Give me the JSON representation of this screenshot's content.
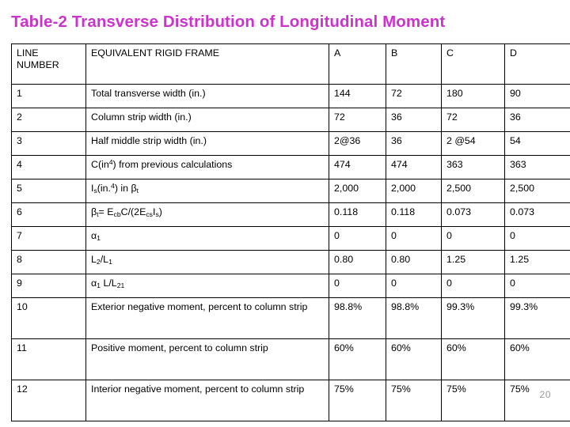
{
  "slide": {
    "title": "Table-2  Transverse Distribution of Longitudinal Moment",
    "title_color": "#cc33cc",
    "page_number": "20"
  },
  "table": {
    "headers": {
      "line_number_l1": "LINE",
      "line_number_l2": "NUMBER",
      "description": "EQUIVALENT RIGID FRAME",
      "col_a": "A",
      "col_b": "B",
      "col_c": "C",
      "col_d": "D"
    },
    "rows": [
      {
        "line": "1",
        "desc_pre": "Total transverse width (in.)",
        "desc_sub": "",
        "desc_mid": "",
        "desc_sub2": "",
        "desc_post": "",
        "a": "144",
        "b": "72",
        "c": "180",
        "d": "90"
      },
      {
        "line": "2",
        "desc_pre": "Column strip width (in.)",
        "desc_sub": "",
        "desc_mid": "",
        "desc_sub2": "",
        "desc_post": "",
        "a": "72",
        "b": "36",
        "c": "72",
        "d": "36"
      },
      {
        "line": "3",
        "desc_pre": "Half middle strip width (in.)",
        "desc_sub": "",
        "desc_mid": "",
        "desc_sub2": "",
        "desc_post": "",
        "a": "2@36",
        "b": "36",
        "c": "2 @54",
        "d": "54"
      },
      {
        "line": "4",
        "desc_pre": "C(in",
        "desc_sup": "4",
        "desc_post": ") from previous calculations",
        "a": "474",
        "b": "474",
        "c": "363",
        "d": "363"
      },
      {
        "line": "5",
        "desc_pre": "I",
        "desc_sub": "s",
        "desc_mid": "(in.",
        "desc_sup": "4",
        "desc_mid2": ") in β",
        "desc_sub2": "t",
        "desc_post": "",
        "a": "2,000",
        "b": "2,000",
        "c": "2,500",
        "d": "2,500"
      },
      {
        "line": "6",
        "desc_pre": "β",
        "desc_sub": "t",
        "desc_mid": "= E",
        "desc_sub2": "cb",
        "desc_mid2": "C/(2E",
        "desc_sub3": "cs",
        "desc_mid3": "I",
        "desc_sub4": "s",
        "desc_post": ")",
        "a": "0.118",
        "b": "0.118",
        "c": "0.073",
        "d": "0.073"
      },
      {
        "line": "7",
        "desc_pre": "α",
        "desc_sub": "1",
        "desc_post": "",
        "a": "0",
        "b": "0",
        "c": "0",
        "d": "0"
      },
      {
        "line": "8",
        "desc_pre": "L",
        "desc_sub": "2",
        "desc_mid": "/L",
        "desc_sub2": "1",
        "desc_post": "",
        "a": "0.80",
        "b": "0.80",
        "c": "1.25",
        "d": "1.25"
      },
      {
        "line": "9",
        "desc_pre": "α",
        "desc_sub": "1",
        "desc_mid": " L",
        "desc_sub2": "2",
        "desc_mid2": "/L",
        "desc_sub3": "1",
        "desc_post": "",
        "a": "0",
        "b": "0",
        "c": "0",
        "d": "0"
      },
      {
        "line": "10",
        "desc_pre": "Exterior negative moment, percent to column strip",
        "a": "98.8%",
        "b": "98.8%",
        "c": "99.3%",
        "d": "99.3%"
      },
      {
        "line": "11",
        "desc_pre": "Positive moment, percent to column strip",
        "a": "60%",
        "b": "60%",
        "c": "60%",
        "d": "60%"
      },
      {
        "line": "12",
        "desc_pre": "Interior negative moment, percent to column strip",
        "a": "75%",
        "b": "75%",
        "c": "75%",
        "d": "75%"
      }
    ]
  }
}
